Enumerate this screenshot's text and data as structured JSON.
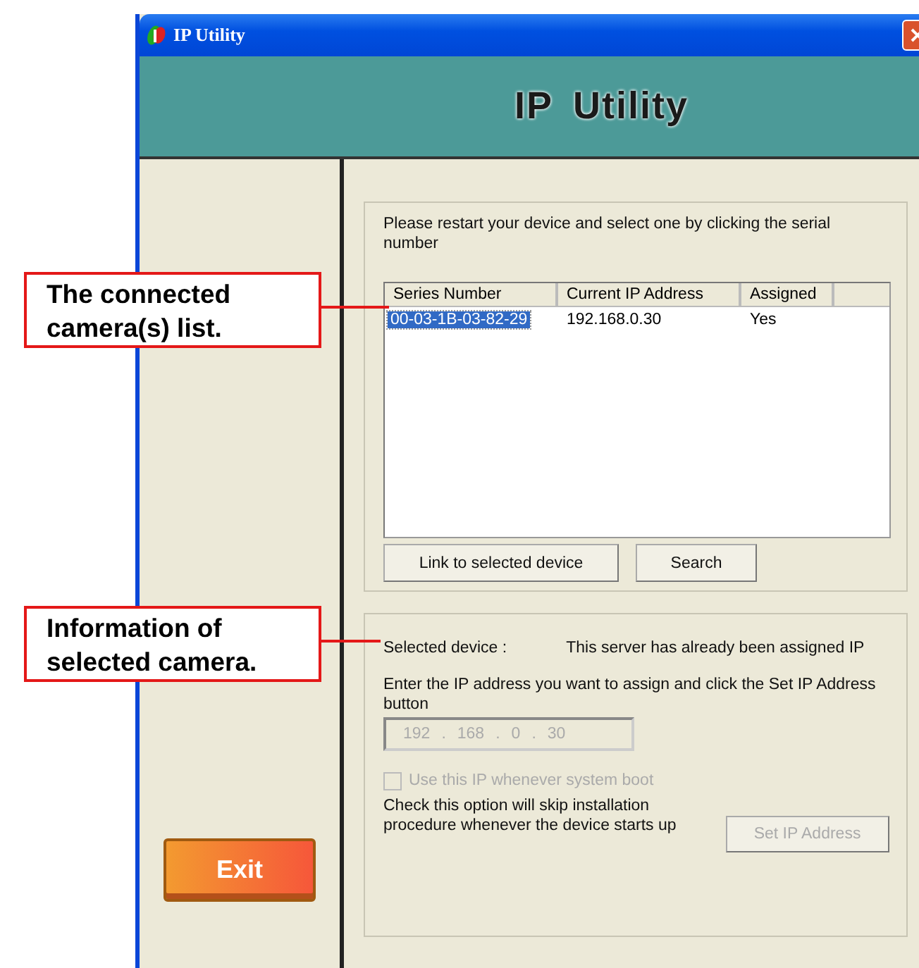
{
  "window": {
    "title": "IP Utility"
  },
  "banner": {
    "title": "IP Utility"
  },
  "sidebar": {
    "exit_button": "Exit"
  },
  "device_list": {
    "instruction": "Please restart your device and select one by clicking the serial number",
    "columns": [
      "Series Number",
      "Current IP Address",
      "Assigned"
    ],
    "rows": [
      {
        "cells": [
          "00-03-1B-03-82-29",
          "192.168.0.30",
          "Yes"
        ],
        "selected": true
      }
    ],
    "buttons": [
      "Link to selected device",
      "Search"
    ]
  },
  "device_info": {
    "label": "Selected device :",
    "status": "This server has already been assigned IP",
    "instruction": "Enter the IP address you want to assign and click the Set IP Address button",
    "ip_field": {
      "octets": [
        "192",
        "168",
        "0",
        "30"
      ],
      "separator": ".",
      "disabled": true
    },
    "checkbox": {
      "label": "Use this IP whenever system boot",
      "checked": false,
      "disabled": true
    },
    "note": "Check this option will skip installation procedure whenever the device starts up",
    "set_button": {
      "label": "Set IP Address",
      "disabled": true
    }
  },
  "callouts": [
    {
      "text": "The connected camera(s) list."
    },
    {
      "text": "Information of selected camera."
    }
  ]
}
